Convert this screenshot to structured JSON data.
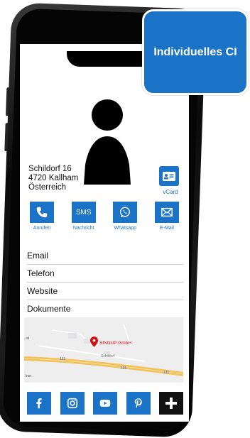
{
  "address": {
    "street": "Schildorf 16",
    "city": "4720 Kallham",
    "country": "Österreich"
  },
  "vcard": {
    "label": "vCard"
  },
  "actions": [
    {
      "label": "Anrufen",
      "icon": "phone-icon"
    },
    {
      "label": "Nachricht",
      "icon": "sms-icon",
      "tile_text": "SMS"
    },
    {
      "label": "Whatsapp",
      "icon": "whatsapp-icon"
    },
    {
      "label": "E-Mail",
      "icon": "mail-icon"
    }
  ],
  "list": [
    "Email",
    "Telefon",
    "Website",
    "Dokumente"
  ],
  "map": {
    "place": "SINNUP GmbH",
    "road_labels": [
      "Schildorf",
      "131",
      "131",
      "131"
    ],
    "edge_labels": [
      "ati",
      "lner"
    ]
  },
  "social": [
    {
      "icon": "facebook-icon"
    },
    {
      "icon": "instagram-icon"
    },
    {
      "icon": "youtube-icon"
    },
    {
      "icon": "pinterest-icon"
    },
    {
      "icon": "plus-icon"
    }
  ],
  "badge": {
    "text": "Individuelles CI"
  },
  "colors": {
    "accent": "#1a73c7",
    "plus_tile": "#111111",
    "pin": "#d11111"
  }
}
